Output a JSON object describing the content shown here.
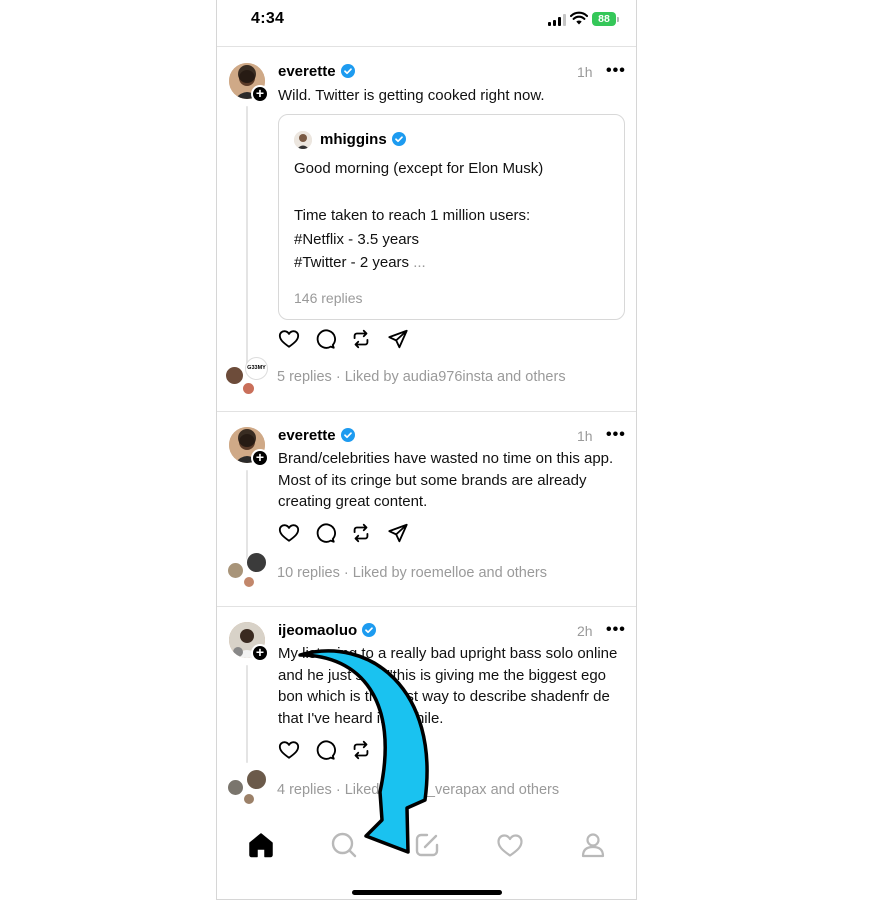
{
  "status_bar": {
    "time": "4:34",
    "battery": "88"
  },
  "posts": [
    {
      "username": "everette",
      "time": "1h",
      "text": "Wild. Twitter is getting cooked right now.",
      "quote": {
        "username": "mhiggins",
        "text": "Good morning (except for Elon Musk)\n\nTime taken to reach 1 million users:\n#Netflix - 3.5 years\n#Twitter - 2 years",
        "truncation": "...",
        "replies": "146 replies"
      },
      "meta": "5 replies · Liked by audia976insta and others",
      "stack_label": "G33MY"
    },
    {
      "username": "everette",
      "time": "1h",
      "text": "Brand/celebrities have wasted no time on this app. Most of its cringe but some brands are already creating great content.",
      "meta": "10 replies · Liked by roemelloe and others"
    },
    {
      "username": "ijeomaoluo",
      "time": "2h",
      "text": "My listening to a really bad upright bass solo online and he just said \"this is giving me the biggest ego bon which is the best way to describe shadenfr de that I've heard in a while.",
      "meta": "4 replies · Liked by b m_verapax and others"
    }
  ],
  "more_label": "•••",
  "tab_bar": {
    "items": [
      "home-icon",
      "search-icon",
      "compose-icon",
      "heart-icon",
      "profile-icon"
    ]
  },
  "colors": {
    "verified": "#1d9bf0",
    "muted": "#9a9a9a",
    "arrow_fill": "#1ac2f0",
    "battery": "#35c759"
  }
}
